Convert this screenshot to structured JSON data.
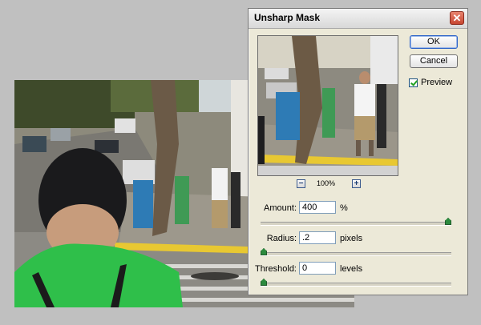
{
  "dialog": {
    "title": "Unsharp Mask",
    "close_glyph": "✕",
    "ok_label": "OK",
    "cancel_label": "Cancel",
    "preview_label": "Preview",
    "preview_checked": true,
    "zoom_out_glyph": "−",
    "zoom_in_glyph": "+",
    "zoom_level": "100%",
    "params": {
      "amount": {
        "label": "Amount:",
        "value": "400",
        "unit": "%",
        "slider_fraction": 1.0
      },
      "radius": {
        "label": "Radius:",
        "value": ".2",
        "unit": "pixels",
        "slider_fraction": 0.0
      },
      "threshold": {
        "label": "Threshold:",
        "value": "0",
        "unit": "levels",
        "slider_fraction": 0.0
      }
    }
  },
  "icons": {
    "close": "close-icon",
    "check": "check-icon",
    "zoom_out": "zoom-out-icon",
    "zoom_in": "zoom-in-icon",
    "slider": "slider-thumb-icon"
  },
  "colors": {
    "dialog_bg": "#ece9d8",
    "close_button": "#c74630",
    "slider_thumb": "#2c8a3e",
    "shirt_green": "#2fbf4a",
    "curb_yellow": "#e8c832"
  }
}
